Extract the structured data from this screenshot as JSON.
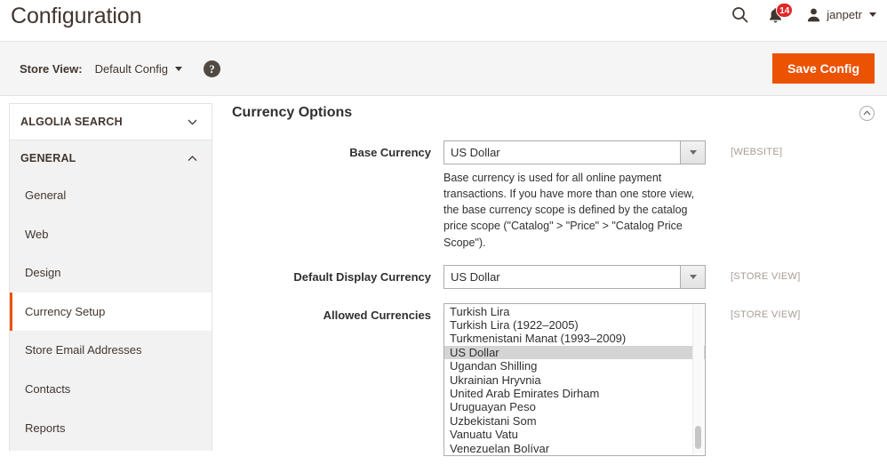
{
  "header": {
    "page_title": "Configuration",
    "search_icon": "search-icon",
    "notifications": {
      "icon": "bell-icon",
      "count": "14"
    },
    "user": {
      "avatar_icon": "user-avatar-icon",
      "name": "janpetr",
      "caret": "chevron-down-icon"
    }
  },
  "storebar": {
    "label": "Store View:",
    "selected": "Default Config",
    "help_icon": "question-mark-icon",
    "save_label": "Save Config"
  },
  "sidebar": {
    "sections": [
      {
        "label": "ALGOLIA SEARCH",
        "expanded": false,
        "items": []
      },
      {
        "label": "GENERAL",
        "expanded": true,
        "items": [
          {
            "label": "General",
            "active": false
          },
          {
            "label": "Web",
            "active": false
          },
          {
            "label": "Design",
            "active": false
          },
          {
            "label": "Currency Setup",
            "active": true
          },
          {
            "label": "Store Email Addresses",
            "active": false
          },
          {
            "label": "Contacts",
            "active": false
          },
          {
            "label": "Reports",
            "active": false
          }
        ]
      }
    ]
  },
  "main": {
    "section_title": "Currency Options",
    "collapse_icon": "chevron-up-circle-icon",
    "fields": {
      "base_currency": {
        "label": "Base Currency",
        "value": "US Dollar",
        "scope": "[WEBSITE]",
        "help": "Base currency is used for all online payment transactions. If you have more than one store view, the base currency scope is defined by the catalog price scope (\"Catalog\" > \"Price\" > \"Catalog Price Scope\")."
      },
      "default_display_currency": {
        "label": "Default Display Currency",
        "value": "US Dollar",
        "scope": "[STORE VIEW]"
      },
      "allowed_currencies": {
        "label": "Allowed Currencies",
        "scope": "[STORE VIEW]",
        "selected": "US Dollar",
        "options": [
          "Turkish Lira",
          "Turkish Lira (1922–2005)",
          "Turkmenistani Manat (1993–2009)",
          "US Dollar",
          "Ugandan Shilling",
          "Ukrainian Hryvnia",
          "United Arab Emirates Dirham",
          "Uruguayan Peso",
          "Uzbekistani Som",
          "Vanuatu Vatu",
          "Venezuelan Bolívar"
        ]
      }
    }
  },
  "colors": {
    "accent": "#eb5202",
    "badge": "#e22626",
    "text": "#41362f"
  }
}
